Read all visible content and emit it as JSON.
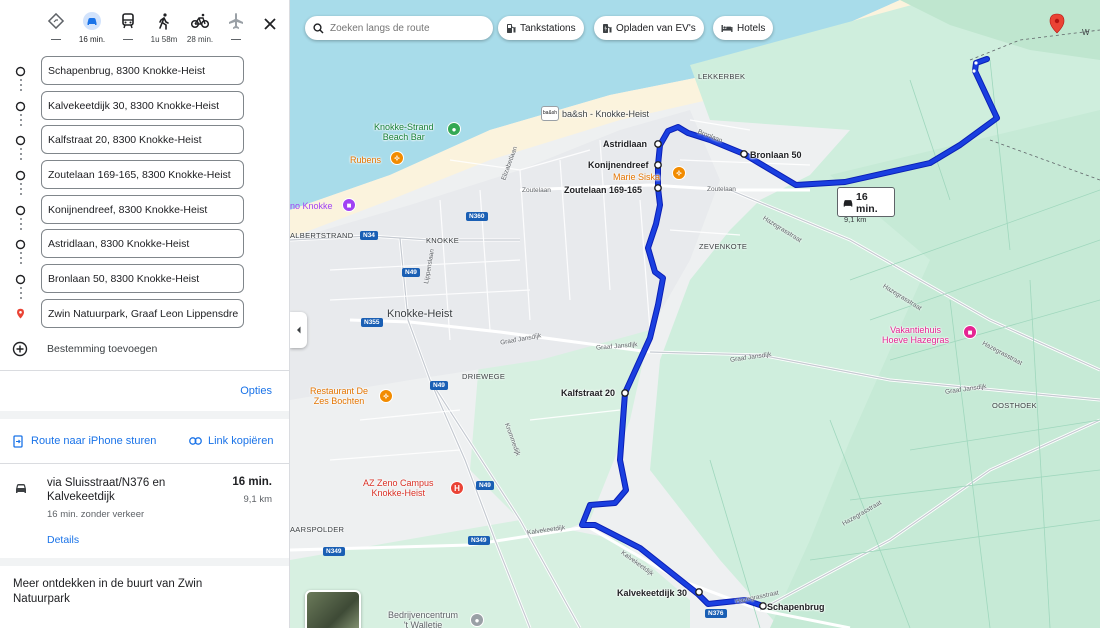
{
  "modes": [
    {
      "name": "best",
      "label": ""
    },
    {
      "name": "car",
      "label": "16 min."
    },
    {
      "name": "transit",
      "label": ""
    },
    {
      "name": "walk",
      "label": "1u 58m"
    },
    {
      "name": "bike",
      "label": "28 min."
    },
    {
      "name": "flight",
      "label": ""
    }
  ],
  "stops": [
    "Schapenbrug, 8300 Knokke-Heist",
    "Kalvekeetdijk 30, 8300 Knokke-Heist",
    "Kalfstraat 20, 8300 Knokke-Heist",
    "Zoutelaan 169-165, 8300 Knokke-Heist",
    "Konijnendreef, 8300 Knokke-Heist",
    "Astridlaan, 8300 Knokke-Heist",
    "Bronlaan 50, 8300 Knokke-Heist",
    "Zwin Natuurpark, Graaf Leon Lippensdre"
  ],
  "add_destination": "Bestemming toevoegen",
  "options_label": "Opties",
  "send_to_phone": "Route naar iPhone sturen",
  "copy_link": "Link kopiëren",
  "route": {
    "via": "via Sluisstraat/N376 en Kalvekeetdijk",
    "time": "16 min.",
    "distance": "9,1 km",
    "traffic": "16 min. zonder verkeer",
    "details": "Details"
  },
  "explore_title": "Meer ontdekken in de buurt van Zwin Natuurpark",
  "map": {
    "search_placeholder": "Zoeken langs de route",
    "chips": [
      "Tankstations",
      "Opladen van EV's",
      "Hotels"
    ],
    "route_time": "16 min.",
    "route_distance": "9,1 km",
    "stop_labels": [
      "Schapenbrug",
      "Kalvekeetdijk 30",
      "Kalfstraat 20",
      "Zoutelaan 169-165",
      "Konijnendreef",
      "Astridlaan",
      "Bronlaan 50"
    ],
    "places": {
      "knokke_heist": "Knokke-Heist",
      "lekkerbek": "LEKKERBEK",
      "zevenkote": "ZEVENKOTE",
      "driewege": "DRIEWEGE",
      "oosthoek": "OOSTHOEK",
      "albertstrand": "ALBERTSTRAND",
      "knokke": "KNOKKE",
      "aarspolder": "AARSPOLDER",
      "no_knokke": "no Knokke"
    },
    "pois": {
      "beach_bar": "Knokke-Strand\nBeach Bar",
      "rubens": "Rubens",
      "marie_siska": "Marie Siska",
      "basch": "ba&sh - Knokke-Heist",
      "restaurant": "Restaurant De\nZes Bochten",
      "az_zeno": "AZ Zeno Campus\nKnokke-Heist",
      "vakantiehuis": "Vakantiehuis\nHoeve Hazegras",
      "bedrijvencentrum": "Bedrijvencentrum\n't Walletje"
    },
    "streets": {
      "zoutelaan1": "Zoutelaan",
      "zoutelaan2": "Zoutelaan",
      "bronlaan": "Bronlaan",
      "hazegrasstraat1": "Hazegrasstraat",
      "hazegrasstraat2": "Hazegrasstraat",
      "hazegrasstraat3": "Hazegrasstraat",
      "hazegrasstraat4": "Hazegrasstraat",
      "graafjansdijk1": "Graaf Jansdijk",
      "graafjansdijk2": "Graaf Jansdijk",
      "graafjansdijk3": "Graaf Jansdijk",
      "graafjansdijk4": "Graaf Jansdijk",
      "elizabetlaan": "Elizabetlaan",
      "lippenslaan": "Lippenslaan",
      "kalvekeetdijk1": "Kalvekeetdijk",
      "kalvekeetdijk2": "Kalvekeetdijk",
      "krommedijk": "Krommedijk",
      "hazegrasstraat5": "Hazegrasstraat"
    },
    "shields": {
      "n34": "N34",
      "n49a": "N49",
      "n49b": "N49",
      "n49c": "N49",
      "n360": "N360",
      "n355": "N355",
      "n349a": "N349",
      "n349b": "N349",
      "n376": "N376"
    },
    "corner": "W"
  },
  "colors": {
    "route": "#1a3fe0",
    "accent": "#1a73e8",
    "water": "#a8dcea",
    "green": "#cfeedd",
    "sand": "#fbf3dd",
    "marker": "#ea4335"
  }
}
